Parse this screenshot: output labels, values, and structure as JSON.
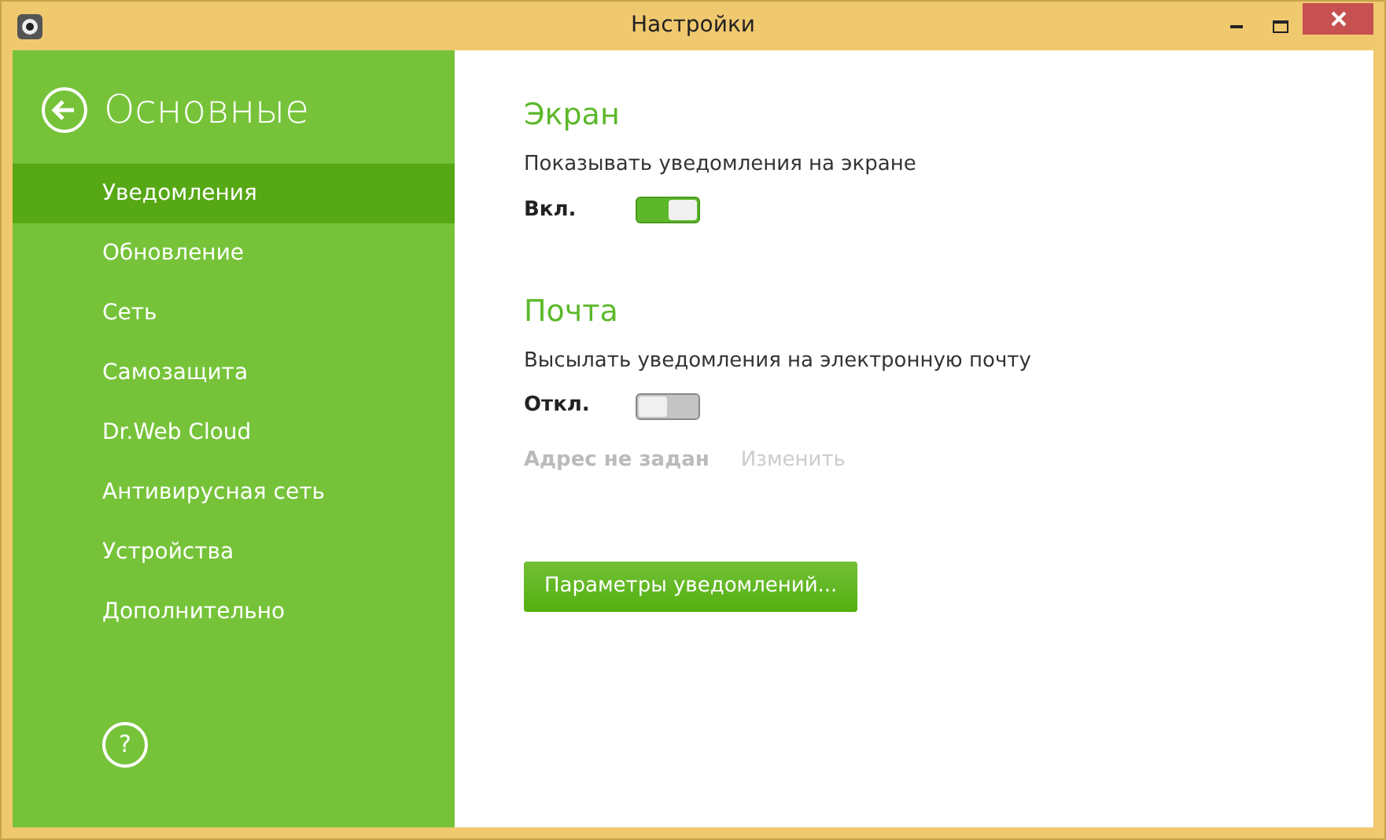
{
  "window": {
    "title": "Настройки"
  },
  "sidebar": {
    "title": "Основные",
    "help": "?",
    "items": [
      {
        "label": "Уведомления",
        "selected": true
      },
      {
        "label": "Обновление",
        "selected": false
      },
      {
        "label": "Сеть",
        "selected": false
      },
      {
        "label": "Самозащита",
        "selected": false
      },
      {
        "label": "Dr.Web Cloud",
        "selected": false
      },
      {
        "label": "Антивирусная сеть",
        "selected": false
      },
      {
        "label": "Устройства",
        "selected": false
      },
      {
        "label": "Дополнительно",
        "selected": false
      }
    ]
  },
  "sections": [
    {
      "title": "Экран",
      "description": "Показывать уведомления на экране",
      "state_label": "Вкл.",
      "on": true
    },
    {
      "title": "Почта",
      "description": "Высылать уведомления на электронную почту",
      "state_label": "Откл.",
      "on": false,
      "address": "Адрес не задан",
      "change_link": "Изменить"
    }
  ],
  "button": "Параметры уведомлений..."
}
